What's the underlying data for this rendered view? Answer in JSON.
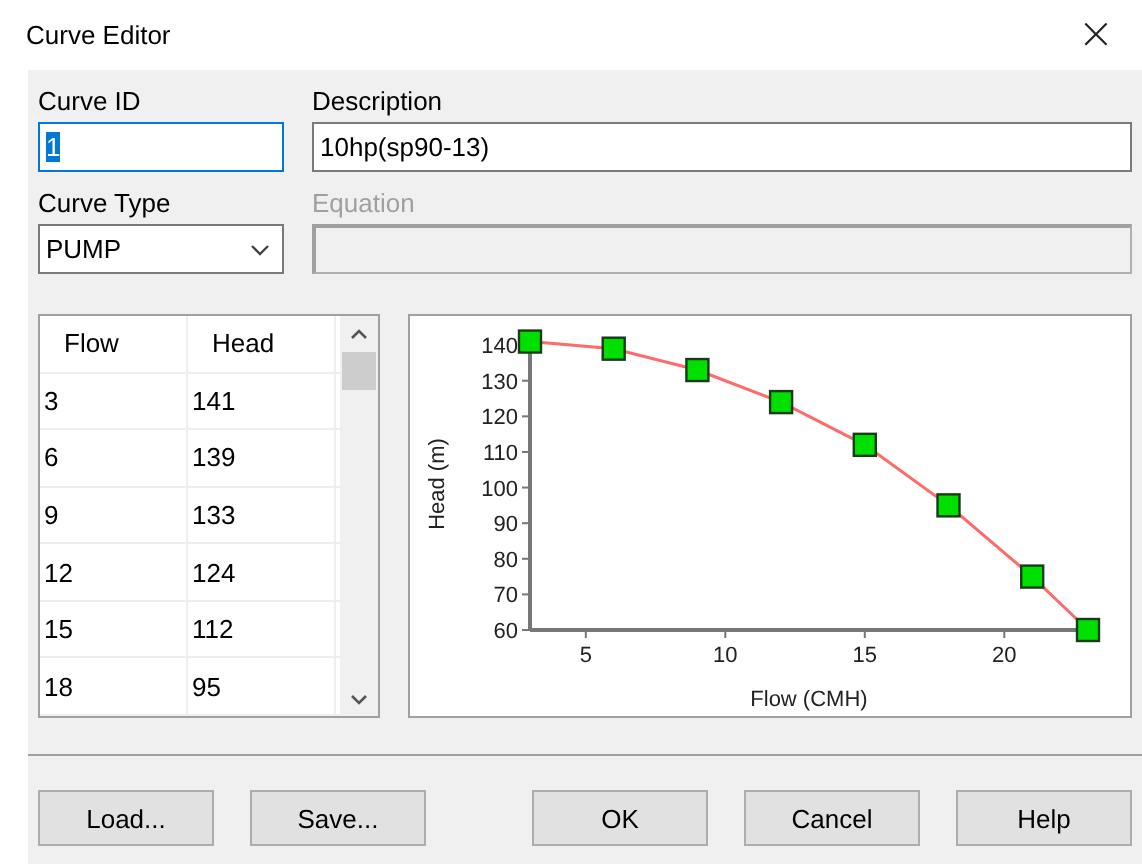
{
  "window": {
    "title": "Curve Editor",
    "close": "×"
  },
  "curve_id": {
    "label": "Curve ID",
    "value": "1",
    "text_selected": true
  },
  "description": {
    "label": "Description",
    "value": "10hp(sp90-13)"
  },
  "curve_type": {
    "label": "Curve Type",
    "value": "PUMP"
  },
  "equation": {
    "label": "Equation",
    "disabled": true
  },
  "table": {
    "columns": [
      "Flow",
      "Head"
    ],
    "rows": [
      {
        "flow": "3",
        "head": "141"
      },
      {
        "flow": "6",
        "head": "139"
      },
      {
        "flow": "9",
        "head": "133"
      },
      {
        "flow": "12",
        "head": "124"
      },
      {
        "flow": "15",
        "head": "112"
      },
      {
        "flow": "18",
        "head": "95"
      }
    ]
  },
  "chart": {
    "chart_data": {
      "type": "line",
      "xlabel": "Flow (CMH)",
      "ylabel": "Head (m)",
      "x": [
        3,
        6,
        9,
        12,
        15,
        18,
        21,
        23
      ],
      "series": [
        {
          "color": "#ff6a6a",
          "marker": "square",
          "values": [
            141,
            139,
            133,
            124,
            112,
            95,
            75,
            60
          ]
        }
      ],
      "xlim": [
        3,
        23
      ],
      "ylim": [
        60,
        142
      ],
      "xticks": [
        5,
        10,
        15,
        20
      ],
      "yticks": [
        60,
        70,
        80,
        90,
        100,
        110,
        120,
        130,
        140
      ]
    }
  },
  "buttons": [
    "Load...",
    "Save...",
    "OK",
    "Cancel",
    "Help"
  ]
}
